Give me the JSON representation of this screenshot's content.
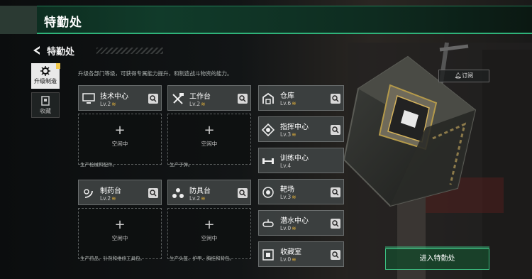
{
  "header": {
    "title": "特勤处"
  },
  "sub_header": {
    "title": "特勤处"
  },
  "sidebar": {
    "items": [
      {
        "label": "升级制造",
        "icon": "upgrade-gear-icon",
        "active": true
      },
      {
        "label": "收藏",
        "icon": "collection-box-icon",
        "active": false
      }
    ]
  },
  "description": "升级各部门等级，可获得专属能力提升，和制造战斗物资的能力。",
  "production_stations": [
    {
      "name": "技术中心",
      "level": "Lv.2",
      "icon": "monitor-icon",
      "slot_status": "空闲中",
      "product_note": "生产枪械和配件。"
    },
    {
      "name": "工作台",
      "level": "Lv.2",
      "icon": "tools-icon",
      "slot_status": "空闲中",
      "product_note": "生产子弹。"
    },
    {
      "name": "制药台",
      "level": "Lv.2",
      "icon": "pharmacy-icon",
      "slot_status": "空闲中",
      "product_note": "生产药品、针剂和维修工具包。"
    },
    {
      "name": "防具台",
      "level": "Lv.2",
      "icon": "armor-icon",
      "slot_status": "空闲中",
      "product_note": "生产头盔、护甲、胸挂和背包。"
    }
  ],
  "departments": [
    {
      "name": "仓库",
      "level": "Lv.6",
      "icon": "warehouse-icon"
    },
    {
      "name": "指挥中心",
      "level": "Lv.3",
      "icon": "command-icon"
    },
    {
      "name": "训练中心",
      "level": "Lv.4",
      "icon": "dumbbell-icon"
    },
    {
      "name": "靶场",
      "level": "Lv.3",
      "icon": "target-icon"
    },
    {
      "name": "潜水中心",
      "level": "Lv.0",
      "icon": "diving-icon"
    },
    {
      "name": "收藏室",
      "level": "Lv.0",
      "icon": "collection-room-icon"
    }
  ],
  "buttons": {
    "subscribe": "订阅",
    "enter": "进入特勤处"
  },
  "colors": {
    "accent": "#2fb37a",
    "level_chevron": "#e7b43a"
  }
}
